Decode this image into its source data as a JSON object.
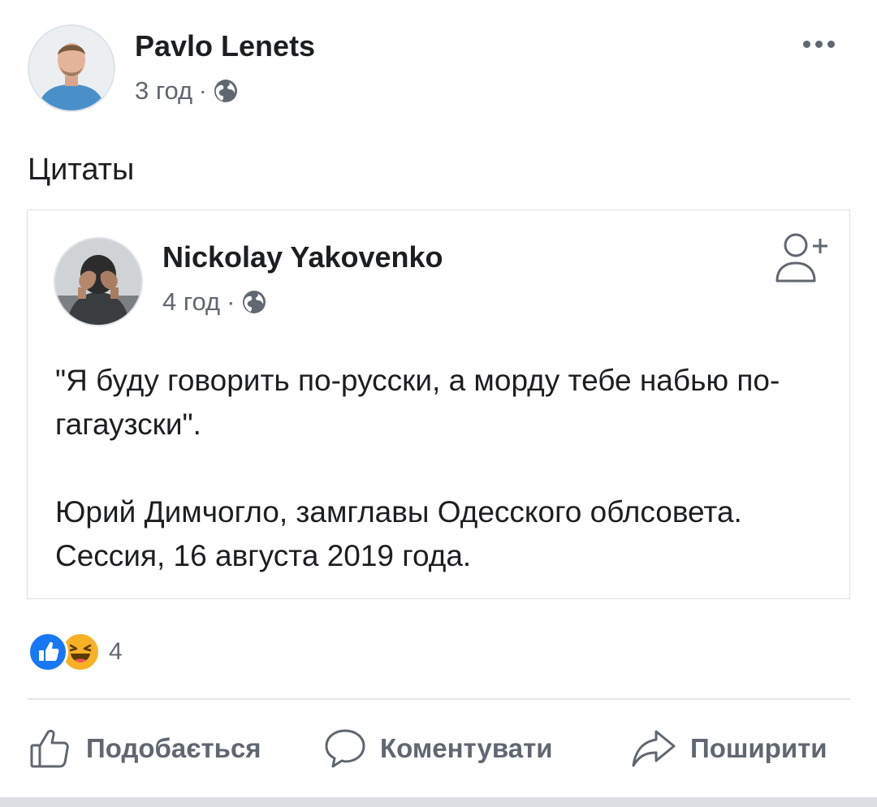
{
  "post": {
    "author_name": "Pavlo Lenets",
    "time": "3 год",
    "separator": "·",
    "privacy_icon": "globe-icon",
    "more_icon": "more-options-icon",
    "text": "Цитаты"
  },
  "shared_post": {
    "author_name": "Nickolay Yakovenko",
    "time": "4 год",
    "separator": "·",
    "privacy_icon": "globe-icon",
    "add_friend_icon": "add-friend-icon",
    "quote": "\"Я буду говорить по-русски, а морду тебе набью по-гагаузски\".",
    "attribution": "Юрий Димчогло, замглавы Одесского облсовета. Сессия, 16 августа 2019 года."
  },
  "reactions": {
    "icons": [
      "like-reaction-icon",
      "haha-reaction-icon"
    ],
    "count": "4"
  },
  "actions": {
    "like_label": "Подобається",
    "comment_label": "Коментувати",
    "share_label": "Поширити"
  },
  "colors": {
    "text_primary": "#1c1e21",
    "text_secondary": "#606770",
    "like_blue": "#1877f2",
    "haha_yellow": "#f7b125",
    "divider": "#e4e6eb"
  }
}
